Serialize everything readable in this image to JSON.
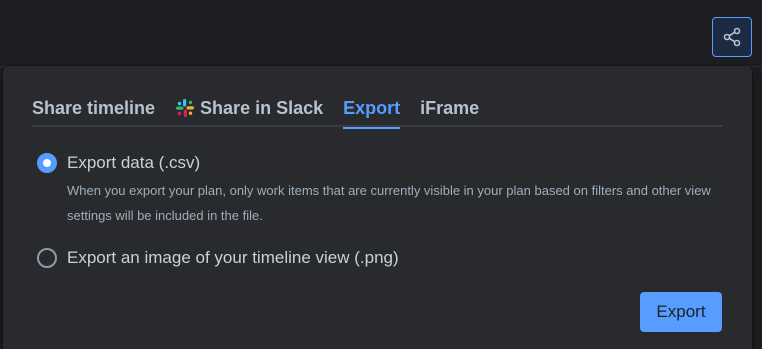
{
  "header": {
    "share_icon": "share-icon"
  },
  "share_dialog": {
    "tabs": [
      {
        "label": "Share timeline",
        "active": false
      },
      {
        "label": "Share in Slack",
        "active": false,
        "icon": "slack-icon"
      },
      {
        "label": "Export",
        "active": true
      },
      {
        "label": "iFrame",
        "active": false
      }
    ],
    "options": [
      {
        "label": "Export data (.csv)",
        "checked": true,
        "description": "When you export your plan, only work items that are currently visible in your plan based on filters and other view settings will be included in the file."
      },
      {
        "label": "Export an image of your timeline view (.png)",
        "checked": false
      }
    ],
    "export_button_label": "Export"
  },
  "colors": {
    "accent": "#579dff",
    "dialog_bg": "#282a2e",
    "page_bg": "#1d1e21",
    "text": "#c7d1db"
  }
}
